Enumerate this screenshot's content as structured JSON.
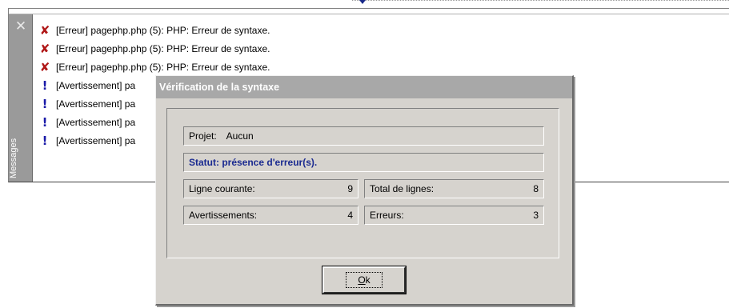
{
  "messages_panel": {
    "title": "Messages",
    "close_icon": "close-icon",
    "rows": [
      {
        "type": "error",
        "icon": "error-x-icon",
        "glyph": "✘",
        "text": "[Erreur] pagephp.php (5): PHP: Erreur de syntaxe."
      },
      {
        "type": "error",
        "icon": "error-x-icon",
        "glyph": "✘",
        "text": "[Erreur] pagephp.php (5): PHP: Erreur de syntaxe."
      },
      {
        "type": "error",
        "icon": "error-x-icon",
        "glyph": "✘",
        "text": "[Erreur] pagephp.php (5): PHP: Erreur de syntaxe."
      },
      {
        "type": "warning",
        "icon": "warning-icon",
        "glyph": "!",
        "text": "[Avertissement] pa"
      },
      {
        "type": "warning",
        "icon": "warning-icon",
        "glyph": "!",
        "text": "[Avertissement] pa"
      },
      {
        "type": "warning",
        "icon": "warning-icon",
        "glyph": "!",
        "text": "[Avertissement] pa"
      },
      {
        "type": "warning",
        "icon": "warning-icon",
        "glyph": "!",
        "text": "[Avertissement] pa"
      }
    ]
  },
  "dialog": {
    "title": "Vérification de la syntaxe",
    "project_label": "Projet:",
    "project_value": "Aucun",
    "status": "Statut: présence d'erreur(s).",
    "current_line_label": "Ligne courante:",
    "current_line_value": "9",
    "total_lines_label": "Total de lignes:",
    "total_lines_value": "8",
    "warnings_label": "Avertissements:",
    "warnings_value": "4",
    "errors_label": "Erreurs:",
    "errors_value": "3",
    "ok_mnemonic": "O",
    "ok_rest": "k"
  },
  "colors": {
    "error": "#b01818",
    "warning": "#1a1aa8",
    "status_text": "#1a2a90",
    "dialog_bg": "#d6d3ce"
  }
}
